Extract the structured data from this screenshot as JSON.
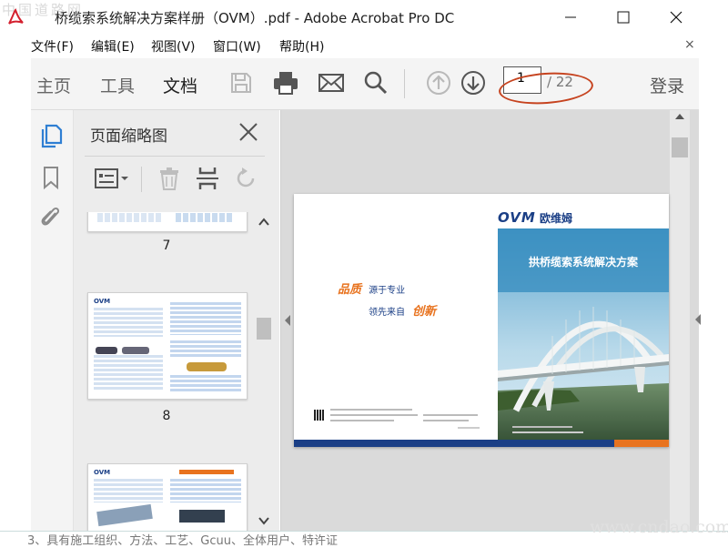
{
  "window": {
    "title": "桥缆索系统解决方案样册（OVM）.pdf - Adobe Acrobat Pro DC",
    "watermark_left": "中国道路网",
    "watermark_right": "www.cndao.com"
  },
  "menubar": {
    "items": [
      "文件(F)",
      "编辑(E)",
      "视图(V)",
      "窗口(W)",
      "帮助(H)"
    ],
    "close_glyph": "×"
  },
  "toolbar": {
    "tabs": [
      "主页",
      "工具",
      "文档"
    ],
    "active_tab": "文档",
    "icons": [
      "save-icon",
      "print-icon",
      "mail-icon",
      "search-icon",
      "page-up-icon",
      "page-down-icon"
    ],
    "current_page": "1",
    "total_pages": "/ 22",
    "signin": "登录",
    "annotation_color": "#c6431f"
  },
  "nav": {
    "icons": [
      "page-thumbnails-icon",
      "bookmark-icon",
      "attachment-icon"
    ],
    "accent": "#2f7fd3"
  },
  "thumbnails_panel": {
    "title": "页面缩略图",
    "tool_icons": [
      "page-options-icon",
      "delete-icon",
      "crop-icon",
      "rotate-icon"
    ],
    "pages": [
      {
        "number": "7"
      },
      {
        "number": "8"
      },
      {
        "number": ""
      }
    ],
    "thumb_logo": "OVM"
  },
  "document": {
    "logo_text": "OVM",
    "logo_cn": "欧维姆",
    "banner_title": "拱桥缆索系统解决方案",
    "slogan_line1_em": "品质",
    "slogan_line1": "源于专业",
    "slogan_line2": "领先来自",
    "slogan_line2_em": "创新",
    "brand_blue": "#1b3f86",
    "brand_orange": "#e8731f"
  },
  "footer": {
    "text": "3、具有施工组织、方法、工艺、Gcuu、全体用户、特许证"
  }
}
